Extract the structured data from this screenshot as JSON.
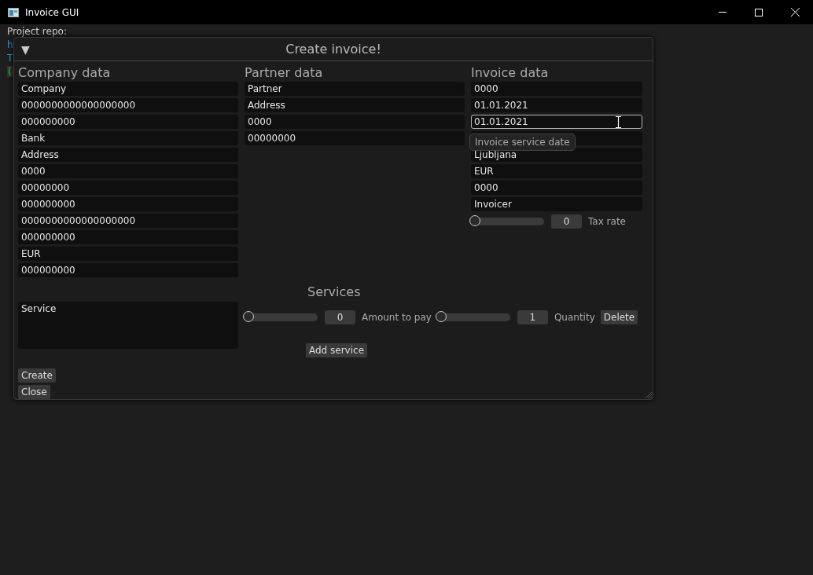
{
  "window": {
    "title": "Invoice GUI"
  },
  "background": {
    "repo_label": "Project repo:",
    "link": "h",
    "text": "T",
    "button": "("
  },
  "dialog": {
    "title": "Create invoice!",
    "collapse_glyph": "▼",
    "columns": [
      {
        "heading": "Company data",
        "fields": [
          {
            "value": "Company",
            "focused": false
          },
          {
            "value": "0000000000000000000",
            "focused": false
          },
          {
            "value": "000000000",
            "focused": false
          },
          {
            "value": "Bank",
            "focused": false
          },
          {
            "value": "Address",
            "focused": false
          },
          {
            "value": "0000",
            "focused": false
          },
          {
            "value": "00000000",
            "focused": false
          },
          {
            "value": "000000000",
            "focused": false
          },
          {
            "value": "0000000000000000000",
            "focused": false
          },
          {
            "value": "000000000",
            "focused": false
          },
          {
            "value": "EUR",
            "focused": false
          },
          {
            "value": "000000000",
            "focused": false
          }
        ]
      },
      {
        "heading": "Partner data",
        "fields": [
          {
            "value": "Partner",
            "focused": false
          },
          {
            "value": "Address",
            "focused": false
          },
          {
            "value": "0000",
            "focused": false
          },
          {
            "value": "00000000",
            "focused": false
          }
        ]
      },
      {
        "heading": "Invoice data",
        "fields": [
          {
            "value": "0000",
            "focused": false
          },
          {
            "value": "01.01.2021",
            "focused": false
          },
          {
            "value": "01.01.2021",
            "focused": true
          },
          {
            "focused": false
          },
          {
            "value": "Ljubljana",
            "focused": false
          },
          {
            "value": "EUR",
            "focused": false
          },
          {
            "value": "0000",
            "focused": false
          },
          {
            "value": "Invoicer",
            "focused": false
          }
        ],
        "tax": {
          "level": 0,
          "reading": "0",
          "label": "Tax rate"
        }
      }
    ],
    "tooltip": "Invoice service date",
    "services": {
      "heading": "Services",
      "service_text": "Service",
      "amount": {
        "level": 0,
        "reading": "0",
        "label": "Amount to pay"
      },
      "quantity": {
        "level": 0,
        "reading": "1",
        "label": "Quantity"
      },
      "delete": "Delete",
      "add": "Add service"
    },
    "buttons": [
      "Create",
      "Close"
    ]
  }
}
